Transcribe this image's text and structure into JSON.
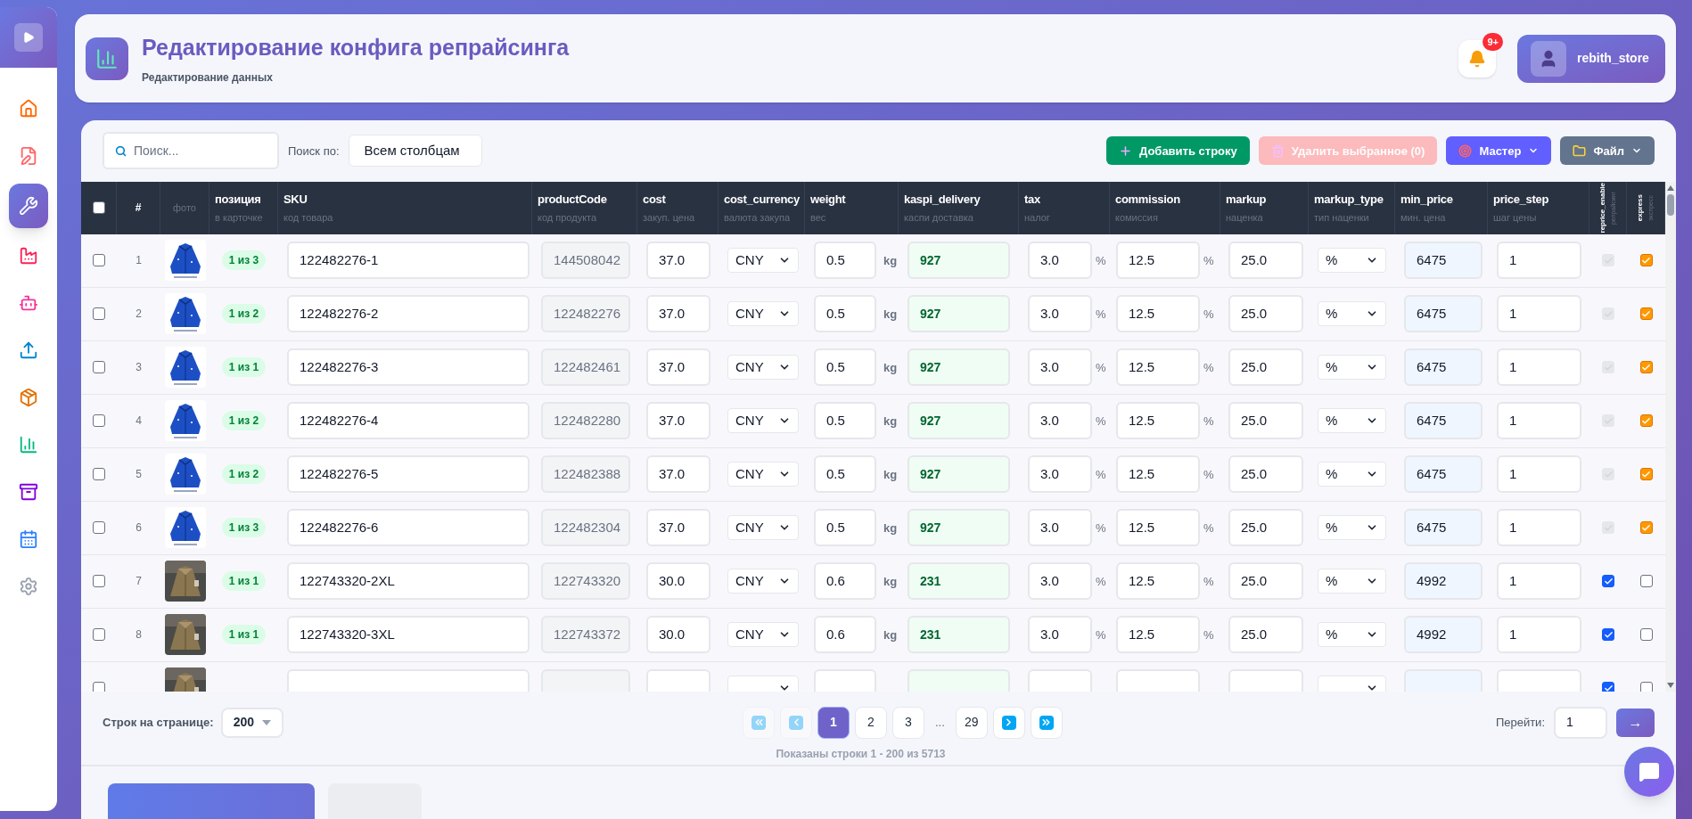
{
  "sidebar": {
    "toggle": {
      "expanded": false
    },
    "items": [
      {
        "selected": false
      },
      {
        "selected": false
      },
      {
        "selected": true
      },
      {
        "selected": false
      },
      {
        "selected": false
      },
      {
        "selected": false
      },
      {
        "selected": false
      },
      {
        "selected": false
      },
      {
        "selected": false
      },
      {
        "selected": false
      },
      {
        "selected": false
      }
    ]
  },
  "header": {
    "title": "Редактирование конфига репрайсинга",
    "subtitle": "Редактирование данных",
    "notifications_badge": "9+",
    "user": "rebith_store"
  },
  "toolbar": {
    "search": {
      "placeholder": "Поиск..."
    },
    "search_by_label": "Поиск по:",
    "search_by": "Всем столбцам",
    "buttons": [
      {
        "kind": "add",
        "label": "Добавить строку",
        "disabled": false
      },
      {
        "kind": "delete",
        "label": "Удалить выбранное (0)",
        "disabled": true
      },
      {
        "kind": "master",
        "label": "Мастер",
        "disabled": false
      },
      {
        "kind": "file",
        "label": "Файл",
        "disabled": false
      }
    ]
  },
  "table": {
    "select_all": {
      "checked": false
    },
    "columns": [
      {
        "name": "#"
      },
      {
        "name": "фото"
      },
      {
        "name": "позиция",
        "sub": "в карточке"
      },
      {
        "name": "SKU",
        "sub": "код товара"
      },
      {
        "name": "productCode",
        "sub": "код продукта"
      },
      {
        "name": "cost",
        "sub": "закуп. цена"
      },
      {
        "name": "cost_currency",
        "sub": "валюта закупа"
      },
      {
        "name": "weight",
        "sub": "вес"
      },
      {
        "name": "kaspi_delivery",
        "sub": "каспи доставка"
      },
      {
        "name": "tax",
        "sub": "налог"
      },
      {
        "name": "commission",
        "sub": "комиссия"
      },
      {
        "name": "markup",
        "sub": "наценка"
      },
      {
        "name": "markup_type",
        "sub": "тип наценки"
      },
      {
        "name": "min_price",
        "sub": "мин. цена"
      },
      {
        "name": "price_step",
        "sub": "шаг цены"
      },
      {
        "name": "reprice_enable",
        "sub": "репрайсинг"
      },
      {
        "name": "express",
        "sub": "экспресс"
      }
    ],
    "rows": [
      {
        "selected": false,
        "number": "1",
        "position": "1 из 3",
        "sku": "122482276-1",
        "product_code": "144508042",
        "cost": "37.0",
        "cost_currency": "CNY",
        "weight": "0.5",
        "weight_unit": "kg",
        "kaspi_delivery": "927",
        "tax": "3.0",
        "tax_unit": "%",
        "commission": "12.5",
        "commission_unit": "%",
        "markup": "25.0",
        "markup_type": "%",
        "min_price": "6475",
        "price_step": "1",
        "reprice_enabled": {
          "checked": true,
          "disabled": true
        },
        "express": {
          "checked": true
        }
      },
      {
        "selected": false,
        "number": "2",
        "position": "1 из 2",
        "sku": "122482276-2",
        "product_code": "122482276",
        "cost": "37.0",
        "cost_currency": "CNY",
        "weight": "0.5",
        "weight_unit": "kg",
        "kaspi_delivery": "927",
        "tax": "3.0",
        "tax_unit": "%",
        "commission": "12.5",
        "commission_unit": "%",
        "markup": "25.0",
        "markup_type": "%",
        "min_price": "6475",
        "price_step": "1",
        "reprice_enabled": {
          "checked": true,
          "disabled": true
        },
        "express": {
          "checked": true
        }
      },
      {
        "selected": false,
        "number": "3",
        "position": "1 из 1",
        "sku": "122482276-3",
        "product_code": "122482461",
        "cost": "37.0",
        "cost_currency": "CNY",
        "weight": "0.5",
        "weight_unit": "kg",
        "kaspi_delivery": "927",
        "tax": "3.0",
        "tax_unit": "%",
        "commission": "12.5",
        "commission_unit": "%",
        "markup": "25.0",
        "markup_type": "%",
        "min_price": "6475",
        "price_step": "1",
        "reprice_enabled": {
          "checked": true,
          "disabled": true
        },
        "express": {
          "checked": true
        }
      },
      {
        "selected": false,
        "number": "4",
        "position": "1 из 2",
        "sku": "122482276-4",
        "product_code": "122482280",
        "cost": "37.0",
        "cost_currency": "CNY",
        "weight": "0.5",
        "weight_unit": "kg",
        "kaspi_delivery": "927",
        "tax": "3.0",
        "tax_unit": "%",
        "commission": "12.5",
        "commission_unit": "%",
        "markup": "25.0",
        "markup_type": "%",
        "min_price": "6475",
        "price_step": "1",
        "reprice_enabled": {
          "checked": true,
          "disabled": true
        },
        "express": {
          "checked": true
        }
      },
      {
        "selected": false,
        "number": "5",
        "position": "1 из 2",
        "sku": "122482276-5",
        "product_code": "122482388",
        "cost": "37.0",
        "cost_currency": "CNY",
        "weight": "0.5",
        "weight_unit": "kg",
        "kaspi_delivery": "927",
        "tax": "3.0",
        "tax_unit": "%",
        "commission": "12.5",
        "commission_unit": "%",
        "markup": "25.0",
        "markup_type": "%",
        "min_price": "6475",
        "price_step": "1",
        "reprice_enabled": {
          "checked": true,
          "disabled": true
        },
        "express": {
          "checked": true
        }
      },
      {
        "selected": false,
        "number": "6",
        "position": "1 из 3",
        "sku": "122482276-6",
        "product_code": "122482304",
        "cost": "37.0",
        "cost_currency": "CNY",
        "weight": "0.5",
        "weight_unit": "kg",
        "kaspi_delivery": "927",
        "tax": "3.0",
        "tax_unit": "%",
        "commission": "12.5",
        "commission_unit": "%",
        "markup": "25.0",
        "markup_type": "%",
        "min_price": "6475",
        "price_step": "1",
        "reprice_enabled": {
          "checked": true,
          "disabled": true
        },
        "express": {
          "checked": true
        }
      },
      {
        "selected": false,
        "number": "7",
        "position": "1 из 1",
        "sku": "122743320-2XL",
        "product_code": "122743320",
        "cost": "30.0",
        "cost_currency": "CNY",
        "weight": "0.6",
        "weight_unit": "kg",
        "kaspi_delivery": "231",
        "tax": "3.0",
        "tax_unit": "%",
        "commission": "12.5",
        "commission_unit": "%",
        "markup": "25.0",
        "markup_type": "%",
        "min_price": "4992",
        "price_step": "1",
        "reprice_enabled": {
          "checked": true,
          "disabled": false
        },
        "express": {
          "checked": false
        }
      },
      {
        "selected": false,
        "number": "8",
        "position": "1 из 1",
        "sku": "122743320-3XL",
        "product_code": "122743372",
        "cost": "30.0",
        "cost_currency": "CNY",
        "weight": "0.6",
        "weight_unit": "kg",
        "kaspi_delivery": "231",
        "tax": "3.0",
        "tax_unit": "%",
        "commission": "12.5",
        "commission_unit": "%",
        "markup": "25.0",
        "markup_type": "%",
        "min_price": "4992",
        "price_step": "1",
        "reprice_enabled": {
          "checked": true,
          "disabled": false
        },
        "express": {
          "checked": false
        }
      },
      {
        "selected": false,
        "reprice_enabled": {
          "checked": true,
          "disabled": false
        },
        "express": {
          "checked": false
        }
      }
    ]
  },
  "footer": {
    "rows_per_page_label": "Строк на странице:",
    "rows_per_page": "200",
    "pagination": {
      "first": {
        "disabled": true
      },
      "prev": {
        "disabled": true
      },
      "pages": [
        {
          "label": "1",
          "selected": true
        },
        {
          "label": "2",
          "selected": false
        },
        {
          "label": "3",
          "selected": false
        },
        {
          "label": "...",
          "kind": "ellipsis"
        },
        {
          "label": "29",
          "selected": false
        }
      ],
      "next": {
        "disabled": false
      },
      "last": {
        "disabled": false
      }
    },
    "info": "Показаны строки 1 - 200 из 5713",
    "goto_label": "Перейти:",
    "goto_value": "1",
    "goto_button": "→"
  },
  "bottom_tabs": [
    {
      "selected": true
    },
    {
      "selected": false
    }
  ]
}
